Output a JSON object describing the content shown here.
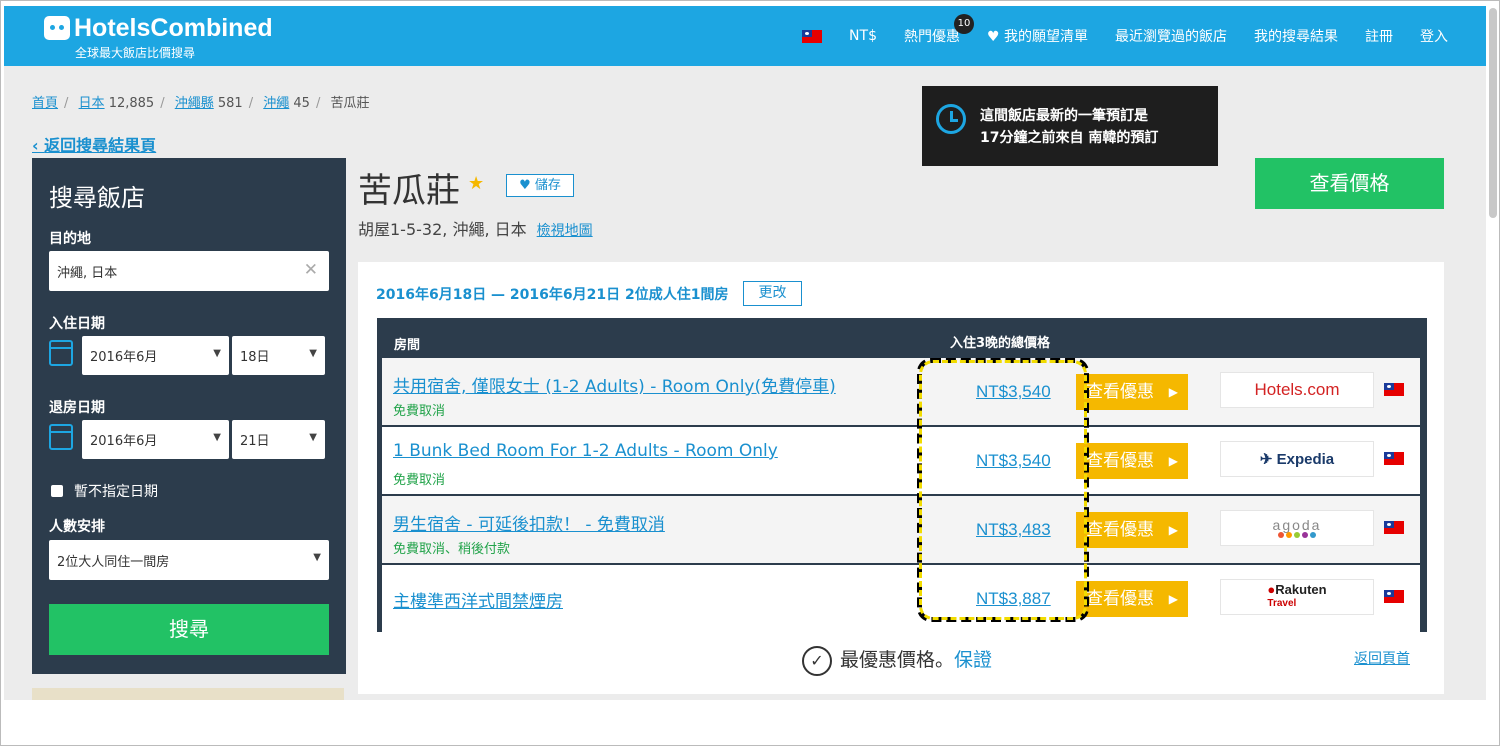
{
  "header": {
    "logo_name": "HotelsCombined",
    "logo_tag": "全球最大飯店比價搜尋",
    "currency": "NT$",
    "hot_deals": "熱門優惠",
    "hot_badge": "10",
    "wishlist": "♥ 我的願望清單",
    "recent": "最近瀏覽過的飯店",
    "my_search": "我的搜尋結果",
    "register": "註冊",
    "login": "登入"
  },
  "breadcrumb": {
    "home": "首頁",
    "japan": "日本",
    "japan_count": "12,885",
    "okinawa_pref": "沖繩縣",
    "okinawa_pref_count": "581",
    "okinawa": "沖繩",
    "okinawa_count": "45",
    "current": "苦瓜莊"
  },
  "back_label": "返回搜尋結果頁",
  "search": {
    "title": "搜尋飯店",
    "destination_label": "目的地",
    "destination_value": "沖繩, 日本",
    "checkin_label": "入住日期",
    "checkin_month": "2016年6月",
    "checkin_day": "18日",
    "checkout_label": "退房日期",
    "checkout_month": "2016年6月",
    "checkout_day": "21日",
    "no_dates_label": "暫不指定日期",
    "guests_label": "人數安排",
    "guests_value": "2位大人同住一間房",
    "button": "搜尋"
  },
  "hotel": {
    "name": "苦瓜莊",
    "star": "★",
    "save": "儲存",
    "address": "胡屋1-5-32, 沖繩, 日本",
    "map_link": "檢視地圖",
    "view_price": "查看價格"
  },
  "tooltip": {
    "line1": "這間飯店最新的一筆預訂是",
    "line2": "17分鐘之前來自 南韓的預訂"
  },
  "rates": {
    "dates": "2016年6月18日 — 2016年6月21日 2位成人住1間房",
    "change": "更改",
    "col_room": "房間",
    "col_price": "入住3晚的總價格",
    "deal_label": "查看優惠",
    "rows": [
      {
        "room": "共用宿舍, 僅限女士 (1-2 Adults) - Room Only(免費停車)",
        "note": "免費取消",
        "price": "NT$3,540",
        "vendor": "Hotels.com"
      },
      {
        "room": "1 Bunk Bed Room For 1-2 Adults - Room Only",
        "note": "免費取消",
        "price": "NT$3,540",
        "vendor": "Expedia"
      },
      {
        "room": "男生宿舍 - 可延後扣款！ - 免費取消",
        "note": "免費取消、稍後付款",
        "price": "NT$3,483",
        "vendor": "agoda"
      },
      {
        "room": "主樓準西洋式間禁煙房",
        "note": "",
        "price": "NT$3,887",
        "vendor": "Rakuten"
      }
    ],
    "rakuten_sub": "Travel"
  },
  "footer": {
    "guarantee": "最優惠價格。",
    "guarantee_link": "保證",
    "back_top": "返回頁首"
  }
}
